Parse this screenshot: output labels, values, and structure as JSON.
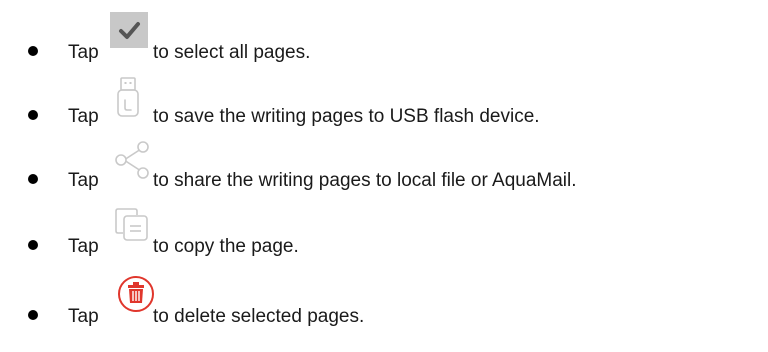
{
  "items": [
    {
      "tap": "Tap",
      "icon": "checkmark-icon",
      "text": "to select all pages."
    },
    {
      "tap": "Tap",
      "icon": "usb-drive-icon",
      "text": "to save the writing pages to USB flash device."
    },
    {
      "tap": "Tap",
      "icon": "share-icon",
      "text": "to share the writing pages to local file or AquaMail."
    },
    {
      "tap": "Tap",
      "icon": "copy-page-icon",
      "text": "to copy the page."
    },
    {
      "tap": "Tap",
      "icon": "trash-icon",
      "text": "to delete selected pages."
    }
  ],
  "colors": {
    "checkmark_bg": "#c8c8c8",
    "icon_gray": "#c9c9c9",
    "delete_red": "#e0362c"
  }
}
